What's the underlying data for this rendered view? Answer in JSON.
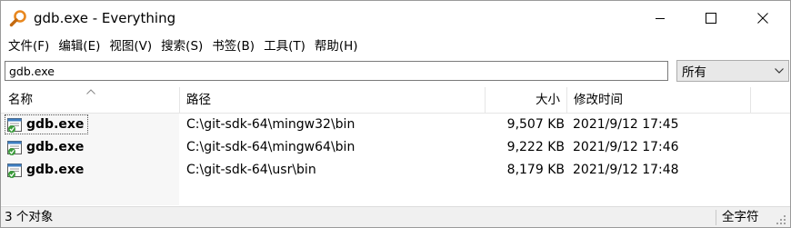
{
  "window": {
    "title": "gdb.exe - Everything",
    "app_icon": "magnifier-icon",
    "controls": [
      "minimize-icon",
      "maximize-icon",
      "close-icon"
    ]
  },
  "menu": [
    {
      "label": "文件(F)"
    },
    {
      "label": "编辑(E)"
    },
    {
      "label": "视图(V)"
    },
    {
      "label": "搜索(S)"
    },
    {
      "label": "书签(B)"
    },
    {
      "label": "工具(T)"
    },
    {
      "label": "帮助(H)"
    }
  ],
  "search": {
    "value": "gdb.exe",
    "filter_selected": "所有"
  },
  "columns": {
    "name": "名称",
    "path": "路径",
    "size": "大小",
    "modified": "修改时间"
  },
  "rows": [
    {
      "name": "gdb.exe",
      "path": "C:\\git-sdk-64\\mingw32\\bin",
      "size": "9,507 KB",
      "modified": "2021/9/12 17:45",
      "icon": "exe-file-icon"
    },
    {
      "name": "gdb.exe",
      "path": "C:\\git-sdk-64\\mingw64\\bin",
      "size": "9,222 KB",
      "modified": "2021/9/12 17:46",
      "icon": "exe-file-icon"
    },
    {
      "name": "gdb.exe",
      "path": "C:\\git-sdk-64\\usr\\bin",
      "size": "8,179 KB",
      "modified": "2021/9/12 17:48",
      "icon": "exe-file-icon"
    }
  ],
  "status": {
    "count": "3 个对象",
    "mode": "全字符"
  },
  "colors": {
    "accent_orange": "#e8871e",
    "icon_green": "#3a9a3a",
    "header_separator": "#e5e5e5",
    "statusbar_bg": "#f0f0f0"
  }
}
